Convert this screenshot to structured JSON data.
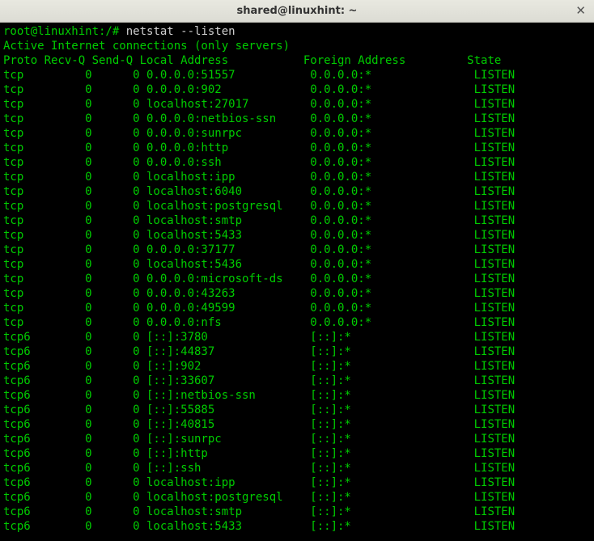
{
  "window_title": "shared@linuxhint: ~",
  "prompt": "root@linuxhint:/#",
  "command": "netstat --listen",
  "subtitle": "Active Internet connections (only servers)",
  "headers": [
    "Proto",
    "Recv-Q",
    "Send-Q",
    "Local Address",
    "Foreign Address",
    "State"
  ],
  "chart_data": {
    "type": "table",
    "columns": [
      "Proto",
      "Recv-Q",
      "Send-Q",
      "Local Address",
      "Foreign Address",
      "State"
    ],
    "rows": [
      [
        "tcp",
        "0",
        "0",
        "0.0.0.0:51557",
        "0.0.0.0:*",
        "LISTEN"
      ],
      [
        "tcp",
        "0",
        "0",
        "0.0.0.0:902",
        "0.0.0.0:*",
        "LISTEN"
      ],
      [
        "tcp",
        "0",
        "0",
        "localhost:27017",
        "0.0.0.0:*",
        "LISTEN"
      ],
      [
        "tcp",
        "0",
        "0",
        "0.0.0.0:netbios-ssn",
        "0.0.0.0:*",
        "LISTEN"
      ],
      [
        "tcp",
        "0",
        "0",
        "0.0.0.0:sunrpc",
        "0.0.0.0:*",
        "LISTEN"
      ],
      [
        "tcp",
        "0",
        "0",
        "0.0.0.0:http",
        "0.0.0.0:*",
        "LISTEN"
      ],
      [
        "tcp",
        "0",
        "0",
        "0.0.0.0:ssh",
        "0.0.0.0:*",
        "LISTEN"
      ],
      [
        "tcp",
        "0",
        "0",
        "localhost:ipp",
        "0.0.0.0:*",
        "LISTEN"
      ],
      [
        "tcp",
        "0",
        "0",
        "localhost:6040",
        "0.0.0.0:*",
        "LISTEN"
      ],
      [
        "tcp",
        "0",
        "0",
        "localhost:postgresql",
        "0.0.0.0:*",
        "LISTEN"
      ],
      [
        "tcp",
        "0",
        "0",
        "localhost:smtp",
        "0.0.0.0:*",
        "LISTEN"
      ],
      [
        "tcp",
        "0",
        "0",
        "localhost:5433",
        "0.0.0.0:*",
        "LISTEN"
      ],
      [
        "tcp",
        "0",
        "0",
        "0.0.0.0:37177",
        "0.0.0.0:*",
        "LISTEN"
      ],
      [
        "tcp",
        "0",
        "0",
        "localhost:5436",
        "0.0.0.0:*",
        "LISTEN"
      ],
      [
        "tcp",
        "0",
        "0",
        "0.0.0.0:microsoft-ds",
        "0.0.0.0:*",
        "LISTEN"
      ],
      [
        "tcp",
        "0",
        "0",
        "0.0.0.0:43263",
        "0.0.0.0:*",
        "LISTEN"
      ],
      [
        "tcp",
        "0",
        "0",
        "0.0.0.0:49599",
        "0.0.0.0:*",
        "LISTEN"
      ],
      [
        "tcp",
        "0",
        "0",
        "0.0.0.0:nfs",
        "0.0.0.0:*",
        "LISTEN"
      ],
      [
        "tcp6",
        "0",
        "0",
        "[::]:3780",
        "[::]:*",
        "LISTEN"
      ],
      [
        "tcp6",
        "0",
        "0",
        "[::]:44837",
        "[::]:*",
        "LISTEN"
      ],
      [
        "tcp6",
        "0",
        "0",
        "[::]:902",
        "[::]:*",
        "LISTEN"
      ],
      [
        "tcp6",
        "0",
        "0",
        "[::]:33607",
        "[::]:*",
        "LISTEN"
      ],
      [
        "tcp6",
        "0",
        "0",
        "[::]:netbios-ssn",
        "[::]:*",
        "LISTEN"
      ],
      [
        "tcp6",
        "0",
        "0",
        "[::]:55885",
        "[::]:*",
        "LISTEN"
      ],
      [
        "tcp6",
        "0",
        "0",
        "[::]:40815",
        "[::]:*",
        "LISTEN"
      ],
      [
        "tcp6",
        "0",
        "0",
        "[::]:sunrpc",
        "[::]:*",
        "LISTEN"
      ],
      [
        "tcp6",
        "0",
        "0",
        "[::]:http",
        "[::]:*",
        "LISTEN"
      ],
      [
        "tcp6",
        "0",
        "0",
        "[::]:ssh",
        "[::]:*",
        "LISTEN"
      ],
      [
        "tcp6",
        "0",
        "0",
        "localhost:ipp",
        "[::]:*",
        "LISTEN"
      ],
      [
        "tcp6",
        "0",
        "0",
        "localhost:postgresql",
        "[::]:*",
        "LISTEN"
      ],
      [
        "tcp6",
        "0",
        "0",
        "localhost:smtp",
        "[::]:*",
        "LISTEN"
      ],
      [
        "tcp6",
        "0",
        "0",
        "localhost:5433",
        "[::]:*",
        "LISTEN"
      ]
    ]
  }
}
